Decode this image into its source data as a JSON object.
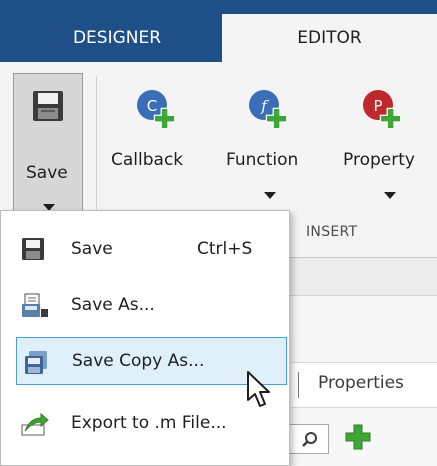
{
  "tabs": [
    {
      "label": "DESIGNER",
      "active": false
    },
    {
      "label": "EDITOR",
      "active": true
    }
  ],
  "toolstrip": {
    "save": {
      "label": "Save",
      "icon": "floppy-disk-icon"
    },
    "tools": [
      {
        "label": "Callback",
        "icon": "callback-add-icon",
        "badge": "C",
        "color": "#3a6fb8",
        "has_dropdown": false
      },
      {
        "label": "Function",
        "icon": "function-add-icon",
        "badge": "f",
        "color": "#3a6fb8",
        "has_dropdown": true
      },
      {
        "label": "Property",
        "icon": "property-add-icon",
        "badge": "P",
        "color": "#c0282d",
        "has_dropdown": true
      }
    ],
    "section_label": "INSERT"
  },
  "save_menu": {
    "items": [
      {
        "label": "Save",
        "shortcut": "Ctrl+S",
        "icon": "floppy-disk-icon",
        "highlighted": false
      },
      {
        "label": "Save As...",
        "shortcut": "",
        "icon": "save-as-icon",
        "highlighted": false
      },
      {
        "label": "Save Copy As...",
        "shortcut": "",
        "icon": "save-copy-icon",
        "highlighted": true
      },
      {
        "label": "Export to .m File...",
        "shortcut": "",
        "icon": "export-icon",
        "highlighted": false
      }
    ]
  },
  "background": {
    "properties_label": "Properties"
  },
  "colors": {
    "tabstrip_blue": "#1e4f87",
    "add_green": "#3fa535",
    "highlight_border": "#46a0d9",
    "highlight_fill": "#dff0fb"
  }
}
